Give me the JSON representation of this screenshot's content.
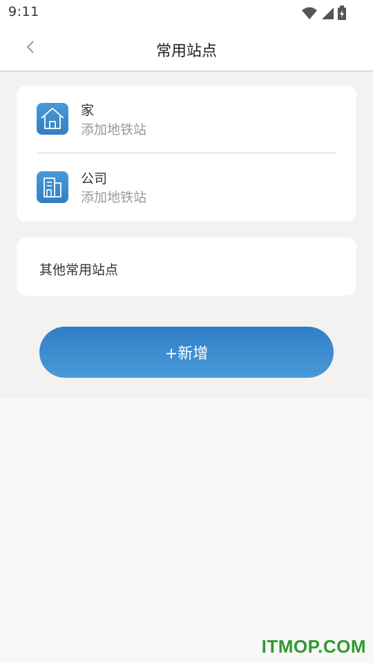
{
  "status_bar": {
    "time": "9:11",
    "icons": [
      "wifi-icon",
      "signal-icon",
      "battery-charging-icon"
    ]
  },
  "header": {
    "title": "常用站点",
    "back_icon": "chevron-left-icon"
  },
  "stations": [
    {
      "icon": "house-icon",
      "title": "家",
      "subtitle": "添加地铁站"
    },
    {
      "icon": "building-icon",
      "title": "公司",
      "subtitle": "添加地铁站"
    }
  ],
  "other": {
    "label": "其他常用站点"
  },
  "add_button": {
    "label": "+新增"
  },
  "watermark": {
    "text": "ITMOP.COM"
  },
  "colors": {
    "accent": "#3a8ed0",
    "page_bg": "#f3f2f1",
    "watermark": "#2f9a2f"
  }
}
